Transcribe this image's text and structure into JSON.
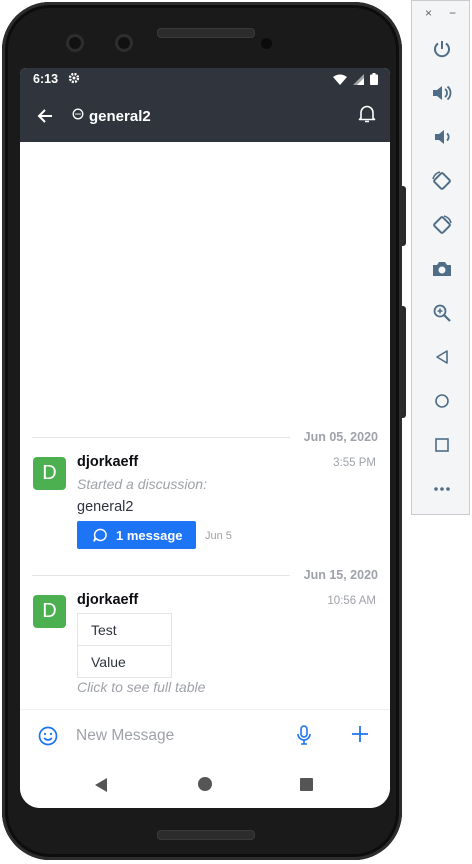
{
  "status_bar": {
    "time": "6:13"
  },
  "app_bar": {
    "room_name": "general2"
  },
  "messages": [
    {
      "date_separator": "Jun 05, 2020",
      "author": "djorkaeff",
      "avatar_letter": "D",
      "time": "3:55 PM",
      "system_text": "Started a discussion:",
      "discussion_name": "general2",
      "thread_button_label": "1 message",
      "thread_date": "Jun 5"
    },
    {
      "date_separator": "Jun 15, 2020",
      "author": "djorkaeff",
      "avatar_letter": "D",
      "time": "10:56 AM",
      "table_rows": [
        "Test",
        "Value"
      ],
      "table_link": "Click to see full table"
    }
  ],
  "composer": {
    "placeholder": "New Message"
  },
  "colors": {
    "header": "#2f343d",
    "accent": "#1d74f5",
    "avatar": "#4caf50"
  },
  "toolbar": {
    "window_controls": [
      "×",
      "−"
    ],
    "icons": [
      "power-icon",
      "volume-up-icon",
      "volume-down-icon",
      "rotate-left-icon",
      "rotate-right-icon",
      "camera-icon",
      "zoom-icon",
      "back-icon",
      "home-icon",
      "overview-icon",
      "more-icon"
    ]
  }
}
